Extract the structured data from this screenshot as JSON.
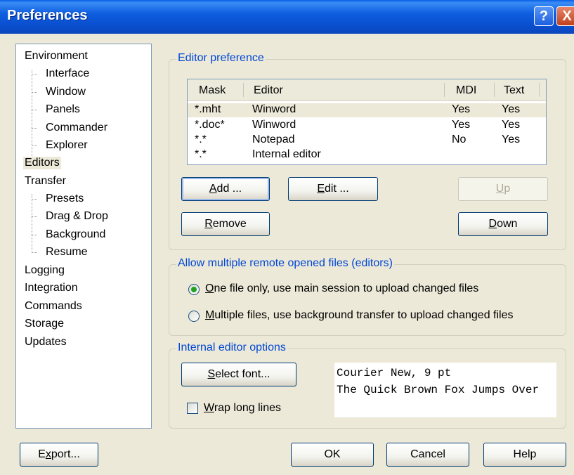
{
  "window": {
    "title": "Preferences"
  },
  "title_buttons": {
    "help": "?",
    "close": "X"
  },
  "tree": {
    "nodes": [
      {
        "label": "Environment",
        "level": 0
      },
      {
        "label": "Interface",
        "level": 1
      },
      {
        "label": "Window",
        "level": 1
      },
      {
        "label": "Panels",
        "level": 1
      },
      {
        "label": "Commander",
        "level": 1
      },
      {
        "label": "Explorer",
        "level": 1
      },
      {
        "label": "Editors",
        "level": 0,
        "selected": true
      },
      {
        "label": "Transfer",
        "level": 0
      },
      {
        "label": "Presets",
        "level": 1
      },
      {
        "label": "Drag & Drop",
        "level": 1
      },
      {
        "label": "Background",
        "level": 1
      },
      {
        "label": "Resume",
        "level": 1
      },
      {
        "label": "Logging",
        "level": 0
      },
      {
        "label": "Integration",
        "level": 0
      },
      {
        "label": "Commands",
        "level": 0
      },
      {
        "label": "Storage",
        "level": 0
      },
      {
        "label": "Updates",
        "level": 0
      }
    ]
  },
  "editor_pref": {
    "title": "Editor preference",
    "columns": [
      "Mask",
      "Editor",
      "MDI",
      "Text"
    ],
    "rows": [
      {
        "mask": "*.mht",
        "editor": "Winword",
        "mdi": "Yes",
        "text": "Yes"
      },
      {
        "mask": "*.doc*",
        "editor": "Winword",
        "mdi": "Yes",
        "text": "Yes"
      },
      {
        "mask": "*.*",
        "editor": "Notepad",
        "mdi": "No",
        "text": "Yes"
      },
      {
        "mask": "*.*",
        "editor": "Internal editor",
        "mdi": "",
        "text": ""
      }
    ],
    "buttons": {
      "add": {
        "u": "A",
        "rest": "dd ..."
      },
      "edit": {
        "u": "E",
        "rest": "dit ..."
      },
      "up": {
        "u": "U",
        "rest": "p"
      },
      "remove": {
        "u": "R",
        "rest": "emove"
      },
      "down": {
        "u": "D",
        "rest": "own"
      }
    }
  },
  "multi_remote": {
    "title": "Allow multiple remote opened files (editors)",
    "option_one": {
      "u": "O",
      "rest": "ne file only, use main session to upload changed files",
      "checked": true
    },
    "option_multiple": {
      "u": "M",
      "rest": "ultiple files, use background transfer to upload changed files",
      "checked": false
    }
  },
  "internal_editor": {
    "title": "Internal editor options",
    "select_font": {
      "u": "S",
      "rest": "elect font..."
    },
    "wrap": {
      "u": "W",
      "rest": "rap long lines",
      "checked": false
    },
    "preview_line1": "Courier New, 9 pt",
    "preview_line2": "The Quick Brown Fox Jumps Over"
  },
  "footer": {
    "export": {
      "pre": "E",
      "u": "x",
      "rest": "port..."
    },
    "ok": "OK",
    "cancel": "Cancel",
    "help": "Help"
  },
  "colors": {
    "title_bar": "#0a5fe6",
    "group_title": "#0046d5",
    "face": "#ece9d8",
    "selected_row": "#ece9d8"
  }
}
